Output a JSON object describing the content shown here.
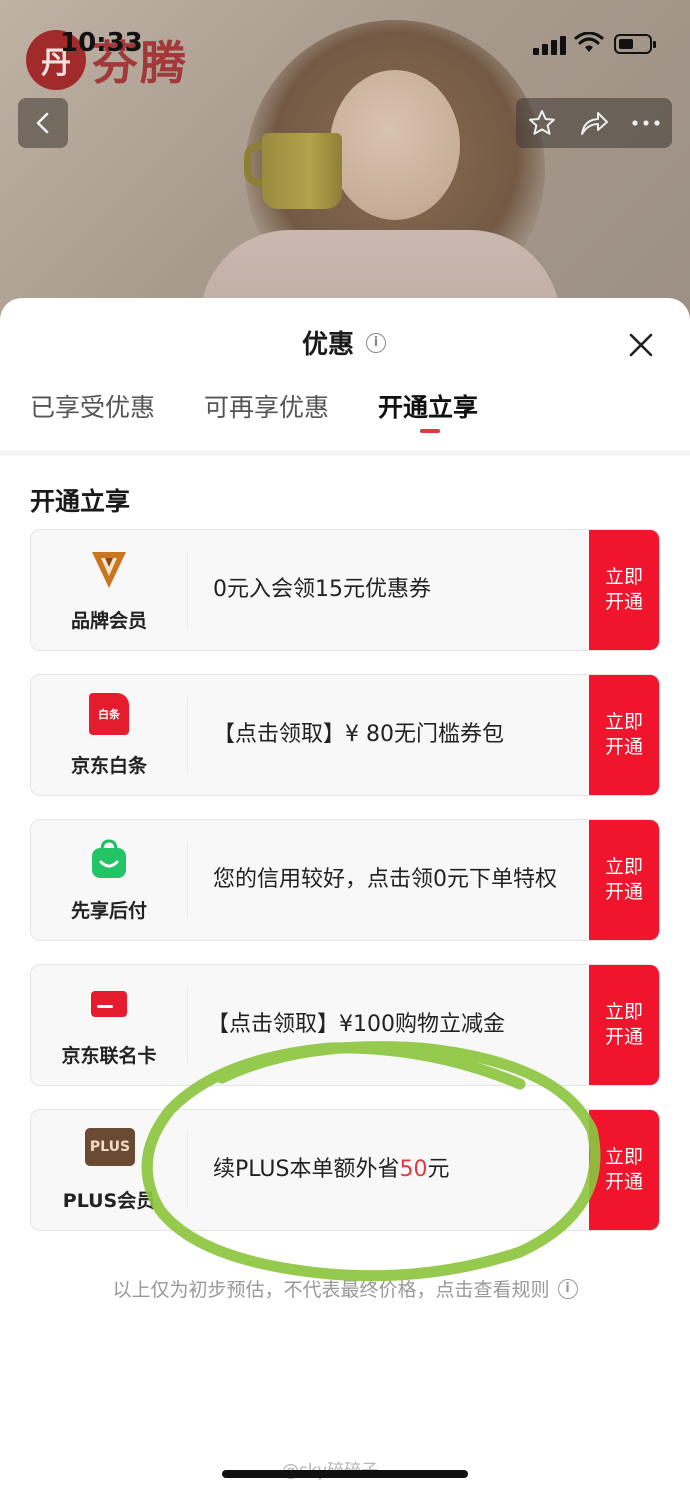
{
  "status_bar": {
    "time": "10:33"
  },
  "background": {
    "logo_text": "芬腾",
    "logo_badge": "丹"
  },
  "sheet": {
    "title": "优惠",
    "tabs": [
      {
        "label": "已享受优惠",
        "active": false
      },
      {
        "label": "可再享优惠",
        "active": false
      },
      {
        "label": "开通立享",
        "active": true
      }
    ],
    "section_title": "开通立享",
    "cards": [
      {
        "name": "品牌会员",
        "icon": "brand-v-icon",
        "desc": "0元入会领15元优惠券",
        "button": [
          "立即",
          "开通"
        ]
      },
      {
        "name": "京东白条",
        "icon": "baitiao-icon",
        "icon_label": "白条",
        "desc": "【点击领取】¥ 80无门槛券包",
        "button": [
          "立即",
          "开通"
        ]
      },
      {
        "name": "先享后付",
        "icon": "shopping-bag-icon",
        "desc": "您的信用较好，点击领0元下单特权",
        "button": [
          "立即",
          "开通"
        ]
      },
      {
        "name": "京东联名卡",
        "icon": "credit-card-icon",
        "desc": "【点击领取】¥100购物立减金",
        "button": [
          "立即",
          "开通"
        ]
      },
      {
        "name": "PLUS会员",
        "icon": "plus-badge-icon",
        "icon_label": "PLUS",
        "desc_prefix": "续PLUS本单额外省",
        "desc_highlight": "50",
        "desc_suffix": "元",
        "button": [
          "立即",
          "开通"
        ]
      }
    ],
    "footnote": "以上仅为初步预估，不代表最终价格，点击查看规则"
  },
  "watermark": "@sky碎碎子",
  "colors": {
    "accent_red": "#f0142c",
    "tab_underline": "#e4393c",
    "annotation_green": "#8cc63f"
  }
}
